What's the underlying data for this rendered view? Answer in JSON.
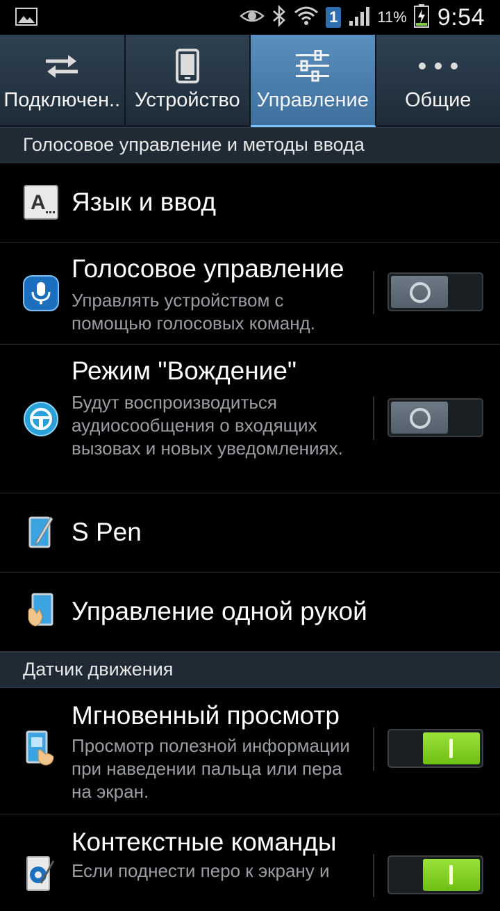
{
  "status_bar": {
    "icons": [
      "picture-icon",
      "smart-stay-eye-icon",
      "bluetooth-icon",
      "wifi-icon",
      "sim1-icon",
      "signal-icon",
      "battery-charging-icon"
    ],
    "sim_label": "1",
    "battery_percent": "11%",
    "time": "9:54"
  },
  "tabs": [
    {
      "label": "Подключен..",
      "icon": "connections-icon",
      "active": false
    },
    {
      "label": "Устройство",
      "icon": "device-icon",
      "active": false
    },
    {
      "label": "Управление",
      "icon": "controls-sliders-icon",
      "active": true
    },
    {
      "label": "Общие",
      "icon": "more-icon",
      "active": false
    }
  ],
  "sections": [
    {
      "header": "Голосовое управление и методы ввода",
      "items": [
        {
          "title": "Язык и ввод",
          "icon": "language-input-icon"
        },
        {
          "title": "Голосовое управление",
          "description": "Управлять устройством с помощью голосовых команд.",
          "icon": "voice-control-icon",
          "toggle": "off"
        },
        {
          "title": "Режим \"Вождение\"",
          "description": "Будут воспроизводиться аудиосообщения о входящих вызовах и новых уведомлениях.",
          "icon": "driving-mode-icon",
          "toggle": "off"
        },
        {
          "title": "S Pen",
          "icon": "s-pen-icon"
        },
        {
          "title": "Управление одной рукой",
          "icon": "one-hand-icon"
        }
      ]
    },
    {
      "header": "Датчик движения",
      "items": [
        {
          "title": "Мгновенный просмотр",
          "description": "Просмотр полезной информации при наведении пальца или пера на экран.",
          "icon": "air-view-icon",
          "toggle": "on"
        },
        {
          "title": "Контекстные команды",
          "description": "Если поднести перо к экрану и",
          "icon": "air-command-icon",
          "toggle": "on"
        }
      ]
    }
  ],
  "colors": {
    "active_tab": "#4f86b8",
    "toggle_on": "#8fd82c",
    "section_header_bg": "#1f2a35",
    "secondary_text": "#9a9ea3"
  }
}
